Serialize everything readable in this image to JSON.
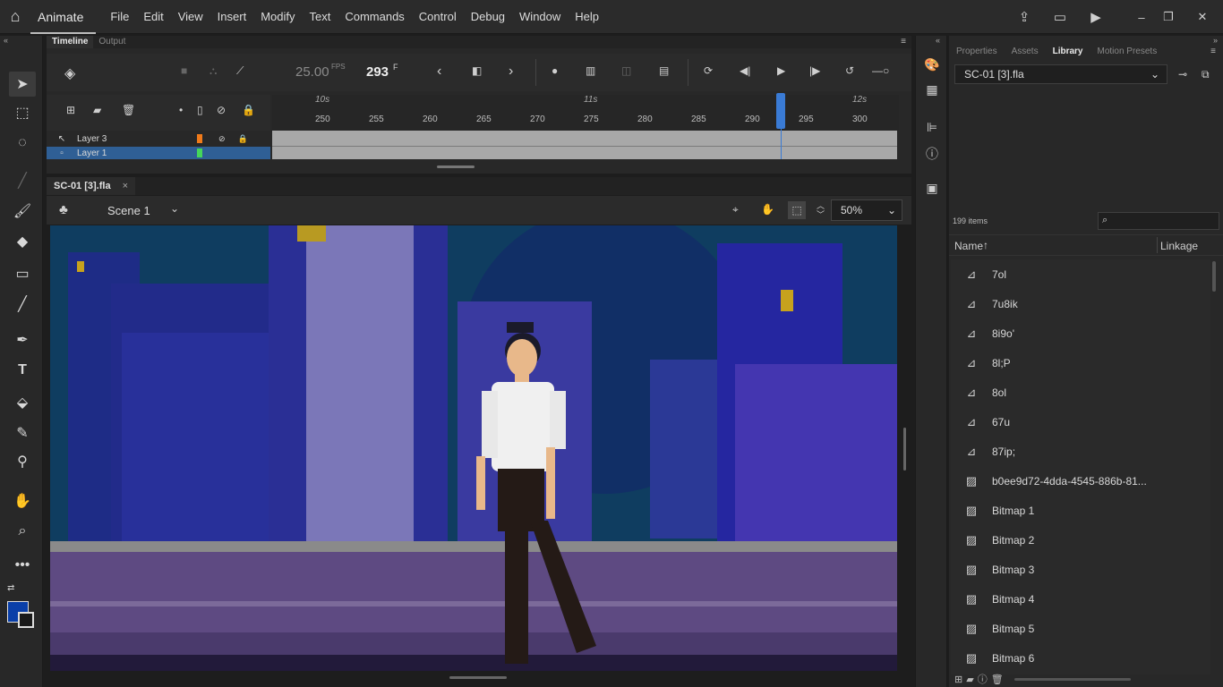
{
  "app": {
    "name": "Animate"
  },
  "menu": [
    "File",
    "Edit",
    "View",
    "Insert",
    "Modify",
    "Text",
    "Commands",
    "Control",
    "Debug",
    "Window",
    "Help"
  ],
  "timeline": {
    "tabs": [
      "Timeline",
      "Output"
    ],
    "fps": "25.00",
    "fps_unit": "FPS",
    "frame": "293",
    "frame_unit": "F",
    "seconds": [
      "10s",
      "11s",
      "12s"
    ],
    "ticks": [
      "250",
      "255",
      "260",
      "265",
      "270",
      "275",
      "280",
      "285",
      "290",
      "295",
      "300"
    ],
    "layers": [
      {
        "name": "Layer 3",
        "color": "#f07a1a"
      },
      {
        "name": "Layer 1",
        "color": "#45d65a"
      }
    ]
  },
  "document": {
    "tab": "SC-01 [3].fla",
    "scene": "Scene 1",
    "zoom": "50%"
  },
  "right_panel": {
    "tabs": [
      "Properties",
      "Assets",
      "Library",
      "Motion Presets"
    ],
    "active_tab": "Library",
    "document": "SC-01 [3].fla",
    "item_count": "199 items",
    "columns": {
      "name": "Name",
      "linkage": "Linkage"
    },
    "items": [
      {
        "name": "7ol",
        "type": "symbol"
      },
      {
        "name": "7u8ik",
        "type": "symbol"
      },
      {
        "name": "8i9o'",
        "type": "symbol"
      },
      {
        "name": "8l;P",
        "type": "symbol"
      },
      {
        "name": "8ol",
        "type": "symbol"
      },
      {
        "name": "67u",
        "type": "symbol"
      },
      {
        "name": "87ip;",
        "type": "symbol"
      },
      {
        "name": "b0ee9d72-4dda-4545-886b-81...",
        "type": "bitmap"
      },
      {
        "name": "Bitmap 1",
        "type": "bitmap"
      },
      {
        "name": "Bitmap 2",
        "type": "bitmap"
      },
      {
        "name": "Bitmap 3",
        "type": "bitmap"
      },
      {
        "name": "Bitmap 4",
        "type": "bitmap"
      },
      {
        "name": "Bitmap 5",
        "type": "bitmap"
      },
      {
        "name": "Bitmap 6",
        "type": "bitmap"
      }
    ]
  },
  "colors": {
    "stroke": "#1a1a1a",
    "fill": "#0a3fa8",
    "accent": "#3a7bd5"
  }
}
